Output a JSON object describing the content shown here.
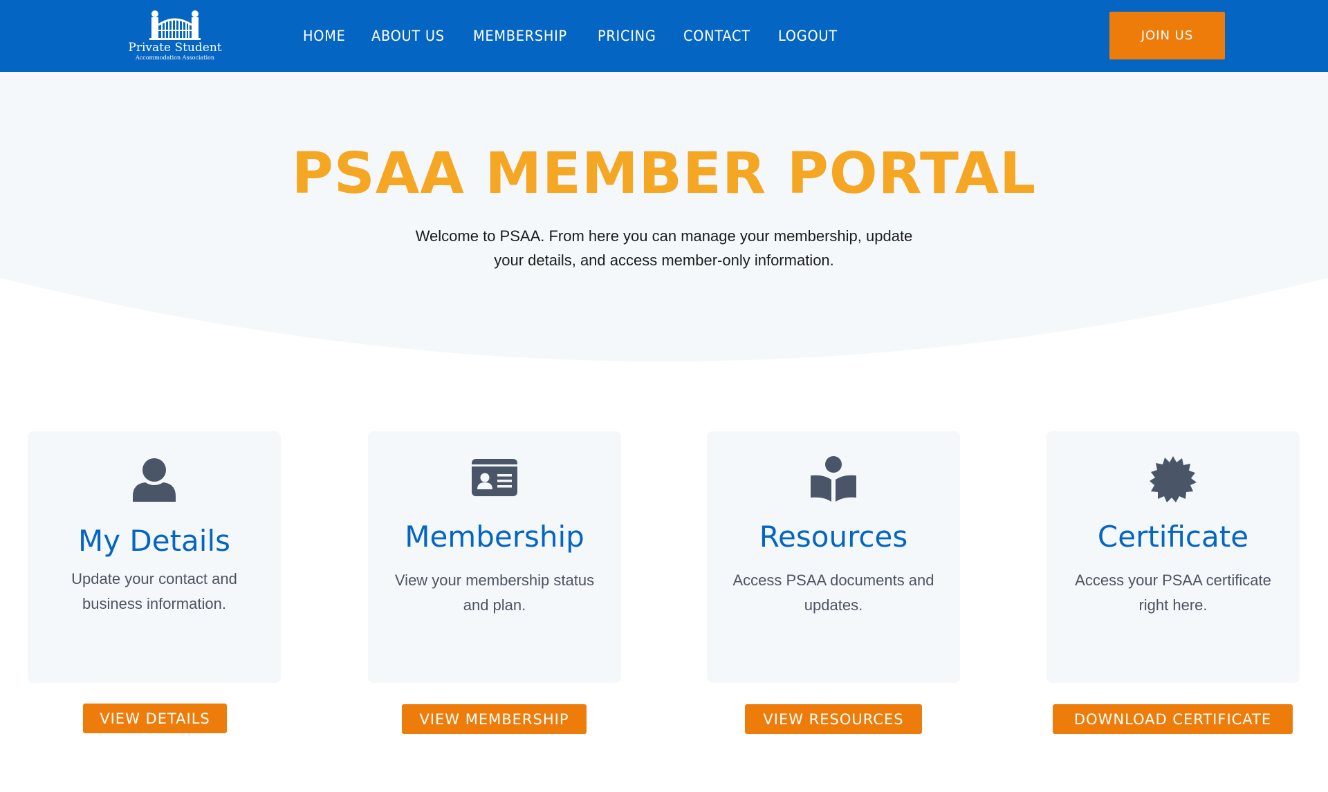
{
  "header": {
    "logo": {
      "line1": "Private Student",
      "line2": "Accommodation Association"
    },
    "nav": [
      "HOME",
      "ABOUT US",
      "MEMBERSHIP",
      "PRICING",
      "CONTACT",
      "LOGOUT"
    ],
    "join_label": "JOIN US"
  },
  "hero": {
    "title": "PSAA MEMBER PORTAL",
    "text": "Welcome to PSAA. From here you can manage your membership, update your details, and access member-only information."
  },
  "cards": [
    {
      "icon": "user-icon",
      "title": "My Details",
      "text": "Update your contact and business information.",
      "button": "VIEW DETAILS"
    },
    {
      "icon": "id-card-icon",
      "title": "Membership",
      "text": "View your membership status and plan.",
      "button": "VIEW MEMBERSHIP"
    },
    {
      "icon": "book-reader-icon",
      "title": "Resources",
      "text": "Access PSAA documents and updates.",
      "button": "VIEW RESOURCES"
    },
    {
      "icon": "certificate-icon",
      "title": "Certificate",
      "text": "Access your PSAA certificate right here.",
      "button": "DOWNLOAD CERTIFICATE"
    }
  ],
  "colors": {
    "header_bg": "#0565c3",
    "accent_orange": "#ee7c0b",
    "title_orange": "#f5a623",
    "card_title_blue": "#0565c3",
    "hero_bg": "#f5f8fb",
    "icon_gray": "#4a5568"
  }
}
